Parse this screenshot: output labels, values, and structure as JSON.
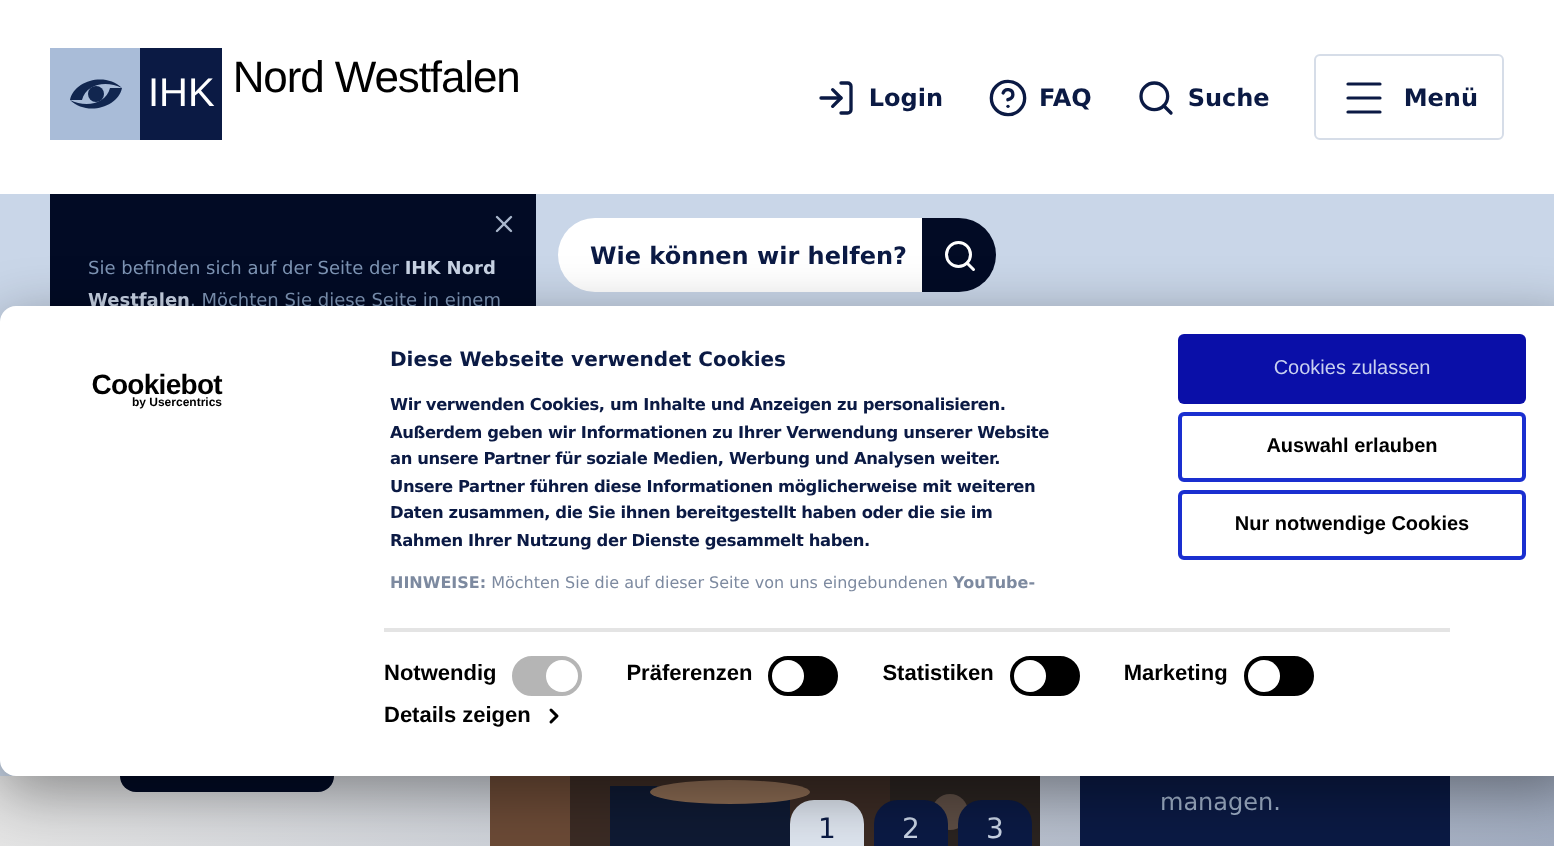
{
  "header": {
    "logo_mark": "IHK",
    "logo_name": "Nord Westfalen",
    "nav": [
      {
        "kind": "login",
        "label": "Login"
      },
      {
        "kind": "faq",
        "label": "FAQ"
      },
      {
        "kind": "search",
        "label": "Suche"
      }
    ],
    "menu_button": "Menü"
  },
  "site_notice": {
    "lines": [
      "Sie befinden sich auf der Seite der **IHK Nord**",
      "**Westfalen**. Möchten Sie diese Seite in einem"
    ]
  },
  "search": {
    "placeholder": "Wie können wir helfen?"
  },
  "cookie_dialog": {
    "brand": "Cookiebot",
    "brand_sub": "by Usercentrics",
    "title": "Diese Webseite verwendet Cookies",
    "body": "Wir verwenden Cookies, um Inhalte und Anzeigen zu personalisieren. Außerdem geben wir Informationen zu Ihrer Verwendung unserer Website an unsere Partner für soziale Medien, Werbung und Analysen weiter. Unsere Partner führen diese Informationen möglicherweise mit weiteren Daten zusammen, die Sie ihnen bereitgestellt haben oder die sie im Rahmen Ihrer Nutzung der Dienste gesammelt haben.",
    "note": "**HINWEISE:** Möchten Sie die auf dieser Seite von uns eingebundenen **YouTube-**",
    "buttons": [
      {
        "kind": "primary",
        "label": "Cookies zulassen"
      },
      {
        "kind": "outline",
        "label": "Auswahl erlauben"
      },
      {
        "kind": "outline",
        "label": "Nur notwendige Cookies"
      }
    ],
    "toggles": [
      {
        "label": "Notwendig",
        "checked": true,
        "disabled": true
      },
      {
        "label": "Präferenzen",
        "checked": false,
        "disabled": false
      },
      {
        "label": "Statistiken",
        "checked": false,
        "disabled": false
      },
      {
        "label": "Marketing",
        "checked": false,
        "disabled": false
      }
    ],
    "details_link": "Details zeigen"
  },
  "carousel": {
    "pages": [
      {
        "label": "1",
        "selected": true
      },
      {
        "label": "2",
        "selected": false
      },
      {
        "label": "3",
        "selected": false
      }
    ]
  },
  "promo": {
    "text": "managen."
  }
}
